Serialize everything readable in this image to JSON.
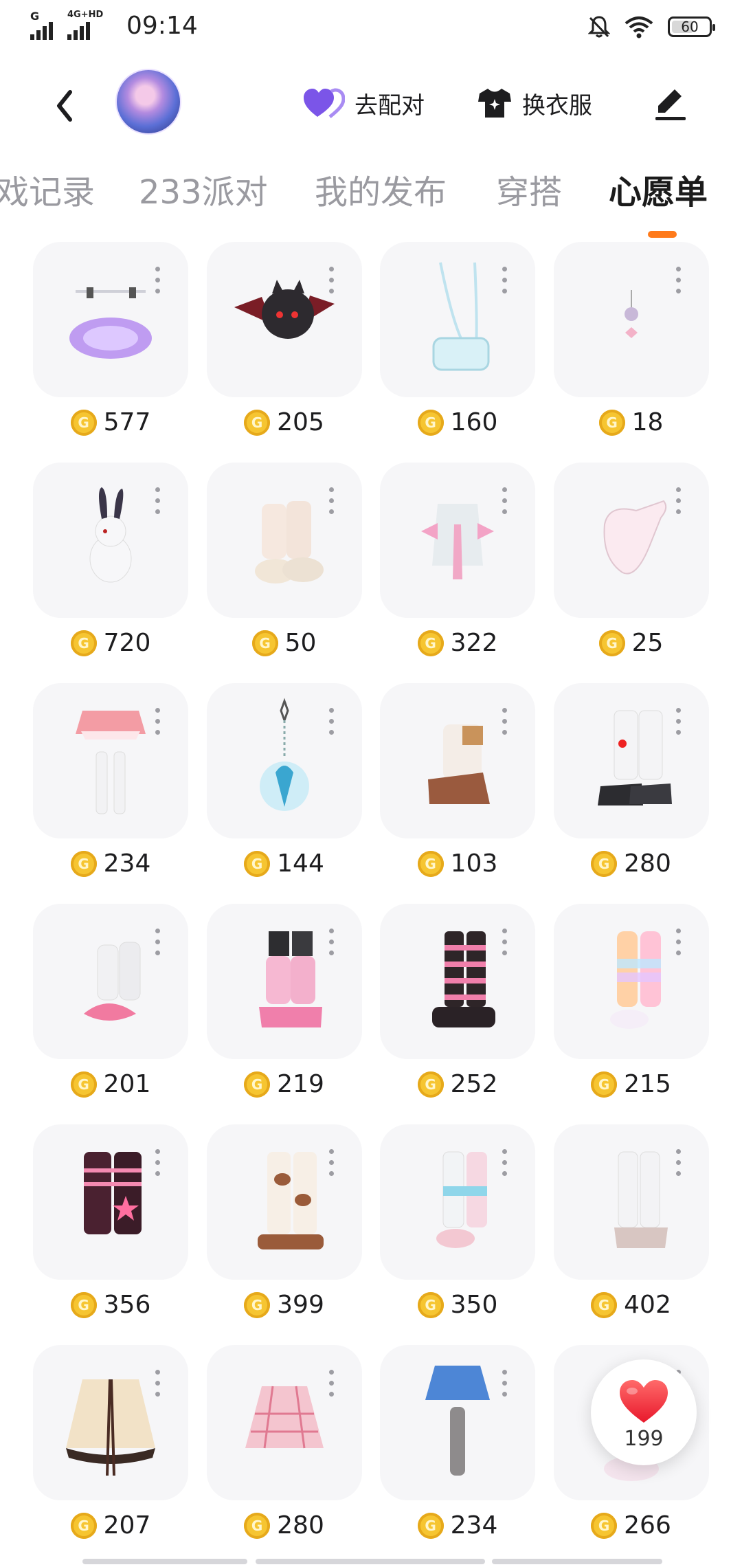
{
  "status_bar": {
    "network_label": "G",
    "network2_label": "4G+HD",
    "time": "09:14",
    "battery": "60",
    "battery_fraction": 0.6
  },
  "header": {
    "icons": {
      "back": "chevron-left-icon",
      "pair": "heart-pair-icon",
      "dress": "tshirt-icon",
      "edit": "pen-icon"
    },
    "pair_label": "去配对",
    "dress_label": "换衣服"
  },
  "tabs": [
    {
      "label": "戏记录",
      "active": false
    },
    {
      "label": "233派对",
      "active": false
    },
    {
      "label": "我的发布",
      "active": false
    },
    {
      "label": "穿搭",
      "active": false
    },
    {
      "label": "心愿单",
      "active": true
    }
  ],
  "accent_color": "#ff7a1a",
  "coin_color": "#f6c531",
  "items": [
    {
      "price": "577",
      "kind": "halo"
    },
    {
      "price": "205",
      "kind": "bat"
    },
    {
      "price": "160",
      "kind": "bag"
    },
    {
      "price": "18",
      "kind": "earring"
    },
    {
      "price": "720",
      "kind": "rabbit"
    },
    {
      "price": "50",
      "kind": "socks-slippers"
    },
    {
      "price": "322",
      "kind": "shirt-bow"
    },
    {
      "price": "25",
      "kind": "glove"
    },
    {
      "price": "234",
      "kind": "skirt-socks"
    },
    {
      "price": "144",
      "kind": "crystal"
    },
    {
      "price": "103",
      "kind": "brown-boots"
    },
    {
      "price": "280",
      "kind": "black-shoes"
    },
    {
      "price": "201",
      "kind": "pink-sandals"
    },
    {
      "price": "219",
      "kind": "pink-legwarmers"
    },
    {
      "price": "252",
      "kind": "striped-boots"
    },
    {
      "price": "215",
      "kind": "rainbow-socks"
    },
    {
      "price": "356",
      "kind": "star-boots"
    },
    {
      "price": "399",
      "kind": "cow-boots"
    },
    {
      "price": "350",
      "kind": "blue-socks"
    },
    {
      "price": "402",
      "kind": "ruffle-socks"
    },
    {
      "price": "207",
      "kind": "cream-skirt"
    },
    {
      "price": "280",
      "kind": "plaid-skirt"
    },
    {
      "price": "234",
      "kind": "denim-skirt"
    },
    {
      "price": "266",
      "kind": "hidden"
    }
  ],
  "like_button": {
    "icon": "heart-icon",
    "count": "199"
  }
}
